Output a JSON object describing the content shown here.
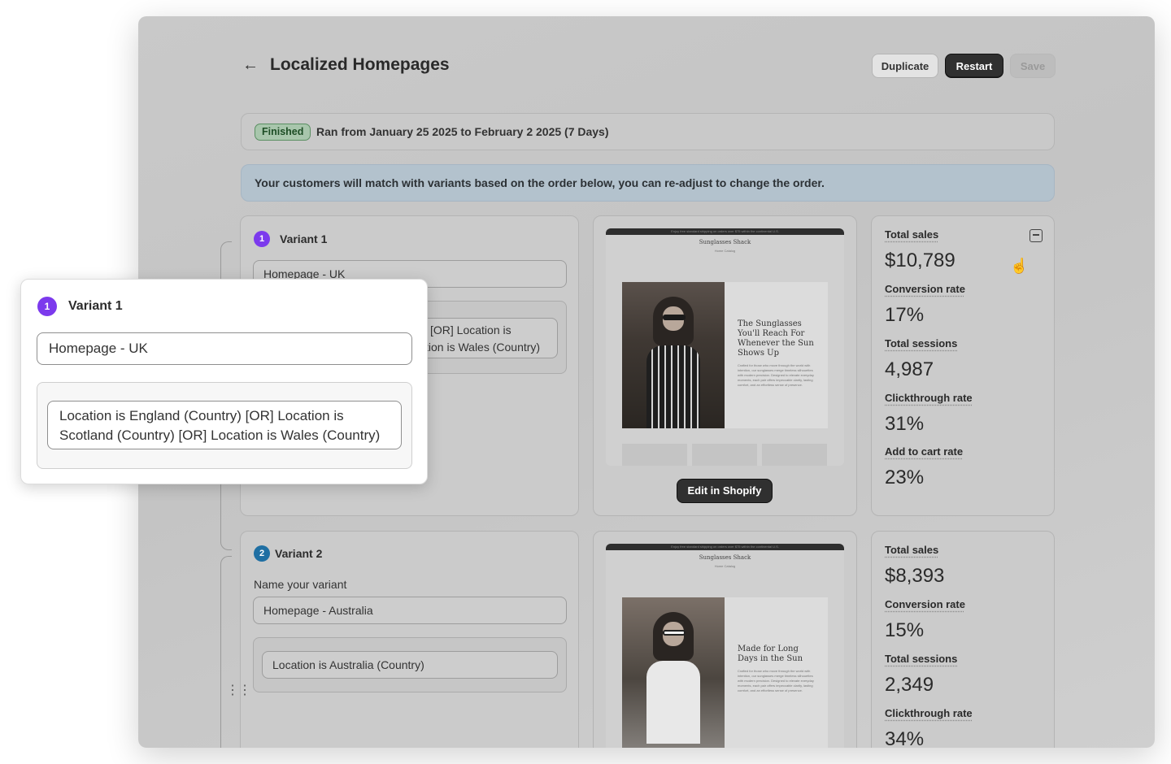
{
  "header": {
    "title": "Localized Homepages",
    "back_icon": "arrow-left-icon",
    "duplicate_label": "Duplicate",
    "restart_label": "Restart",
    "save_label": "Save"
  },
  "status": {
    "badge": "Finished",
    "text": "Ran from January 25 2025 to February 2 2025 (7 Days)"
  },
  "info_banner": "Your customers will match with variants based on the order below, you can re-adjust to change the order.",
  "variants": [
    {
      "number": "1",
      "title": "Variant 1",
      "name_value": "Homepage - UK",
      "rule_line1": "[OR] Location is",
      "rule_line2": "tion is Wales (Country)",
      "preview": {
        "announcement": "Enjoy free standard shipping on orders over $75 within the continental U.S.",
        "brand": "Sunglasses Shack",
        "nav": "Home   Catalog",
        "headline": "The Sunglasses You'll Reach For Whenever the Sun Shows Up",
        "body": "Crafted for those who move through the world with intention, our sunglasses merge timeless silhouettes with modern precision. Designed to elevate everyday moments, each pair offers impeccable clarity, lasting comfort, and an effortless sense of presence."
      },
      "edit_label": "Edit in Shopify",
      "stats": [
        {
          "label": "Total sales",
          "value": "$10,789"
        },
        {
          "label": "Conversion rate",
          "value": "17%"
        },
        {
          "label": "Total sessions",
          "value": "4,987"
        },
        {
          "label": "Clickthrough rate",
          "value": "31%"
        },
        {
          "label": "Add to cart rate",
          "value": "23%"
        }
      ]
    },
    {
      "number": "2",
      "title": "Variant 2",
      "name_label": "Name your variant",
      "name_value": "Homepage - Australia",
      "rule": "Location is Australia (Country)",
      "preview": {
        "announcement": "Enjoy free standard shipping on orders over $75 within the continental U.S.",
        "brand": "Sunglasses Shack",
        "nav": "Home   Catalog",
        "headline": "Made for Long Days in the Sun",
        "body": "Crafted for those who move through the world with intention, our sunglasses merge timeless silhouettes with modern precision. Designed to elevate everyday moments, each pair offers impeccable clarity, lasting comfort, and an effortless sense of presence."
      },
      "stats": [
        {
          "label": "Total sales",
          "value": "$8,393"
        },
        {
          "label": "Conversion rate",
          "value": "15%"
        },
        {
          "label": "Total sessions",
          "value": "2,349"
        },
        {
          "label": "Clickthrough rate",
          "value": "34%"
        }
      ]
    }
  ],
  "overlay": {
    "number": "1",
    "title": "Variant 1",
    "name_value": "Homepage - UK",
    "rule": "Location is England (Country) [OR] Location is Scotland (Country) [OR] Location is Wales (Country)"
  },
  "colors": {
    "variant1_badge": "#7c3aed",
    "variant2_badge": "#1f6fa3",
    "finished_badge": "#a8c6ac",
    "primary_button": "#303030"
  },
  "icons": {
    "export": "export-icon",
    "cursor": "pointer-hand-icon",
    "drag": "drag-handle-icon"
  }
}
